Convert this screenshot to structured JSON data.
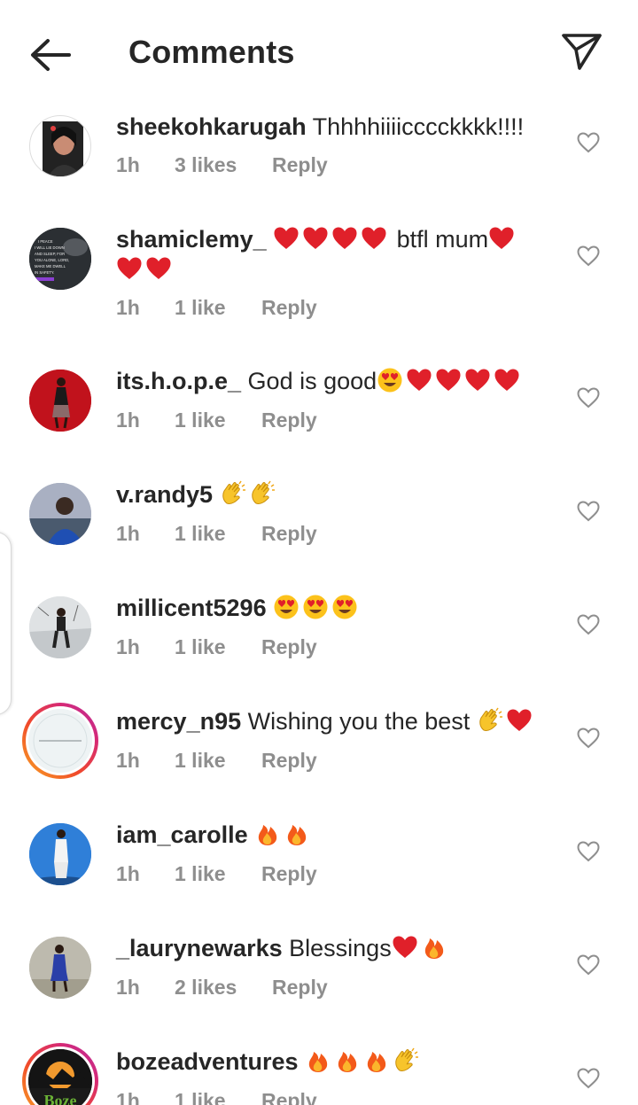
{
  "header": {
    "title": "Comments",
    "back_icon": "arrow-left-icon",
    "send_icon": "send-paper-plane-icon"
  },
  "comments": [
    {
      "username": "sheekohkarugah",
      "text": "Thhhhiiiicccckkkk!!!!",
      "emojis_after": [],
      "time": "1h",
      "likes": "3 likes",
      "reply": "Reply"
    },
    {
      "username": "shamiclemy_",
      "text": "",
      "emojis_mid": [
        "red-heart",
        "red-heart",
        "red-heart",
        "red-heart"
      ],
      "text2": " btfl mum",
      "emojis_after": [
        "red-heart",
        "red-heart",
        "red-heart"
      ],
      "time": "1h",
      "likes": "1 like",
      "reply": "Reply",
      "avatar_poster_text": [
        "I PEACE",
        "I WILL LIE DOWN",
        "AND SLEEP, FOR",
        "YOU ALONE, LORD,",
        "MAKE ME DWELL",
        "IN SAFETY."
      ]
    },
    {
      "username": "its.h.o.p.e_",
      "text": "God is good",
      "emojis_after": [
        "heart-eyes",
        "red-heart",
        "red-heart",
        "red-heart",
        "red-heart"
      ],
      "time": "1h",
      "likes": "1 like",
      "reply": "Reply"
    },
    {
      "username": "v.randy5",
      "text": "",
      "emojis_after": [
        "clapping-hands",
        "clapping-hands"
      ],
      "time": "1h",
      "likes": "1 like",
      "reply": "Reply"
    },
    {
      "username": "millicent5296",
      "text": "",
      "emojis_after": [
        "heart-eyes",
        "heart-eyes",
        "heart-eyes"
      ],
      "time": "1h",
      "likes": "1 like",
      "reply": "Reply"
    },
    {
      "username": "mercy_n95",
      "text": "Wishing you the best",
      "emojis_after": [
        "clapping-hands",
        "red-heart"
      ],
      "time": "1h",
      "likes": "1 like",
      "reply": "Reply"
    },
    {
      "username": "iam_carolle",
      "text": "",
      "emojis_after": [
        "fire",
        "fire"
      ],
      "time": "1h",
      "likes": "1 like",
      "reply": "Reply"
    },
    {
      "username": "_laurynewarks",
      "text": "Blessings",
      "emojis_after": [
        "red-heart",
        "fire"
      ],
      "time": "1h",
      "likes": "2 likes",
      "reply": "Reply"
    },
    {
      "username": "bozeadventures",
      "text": "",
      "emojis_after": [
        "fire",
        "fire",
        "fire",
        "clapping-hands"
      ],
      "time": "1h",
      "likes": "1 like",
      "reply": "Reply",
      "avatar_logo_text": "Boze"
    }
  ],
  "colors": {
    "text": "#262626",
    "meta": "#8e8e8e",
    "heart": "#e0202a"
  }
}
